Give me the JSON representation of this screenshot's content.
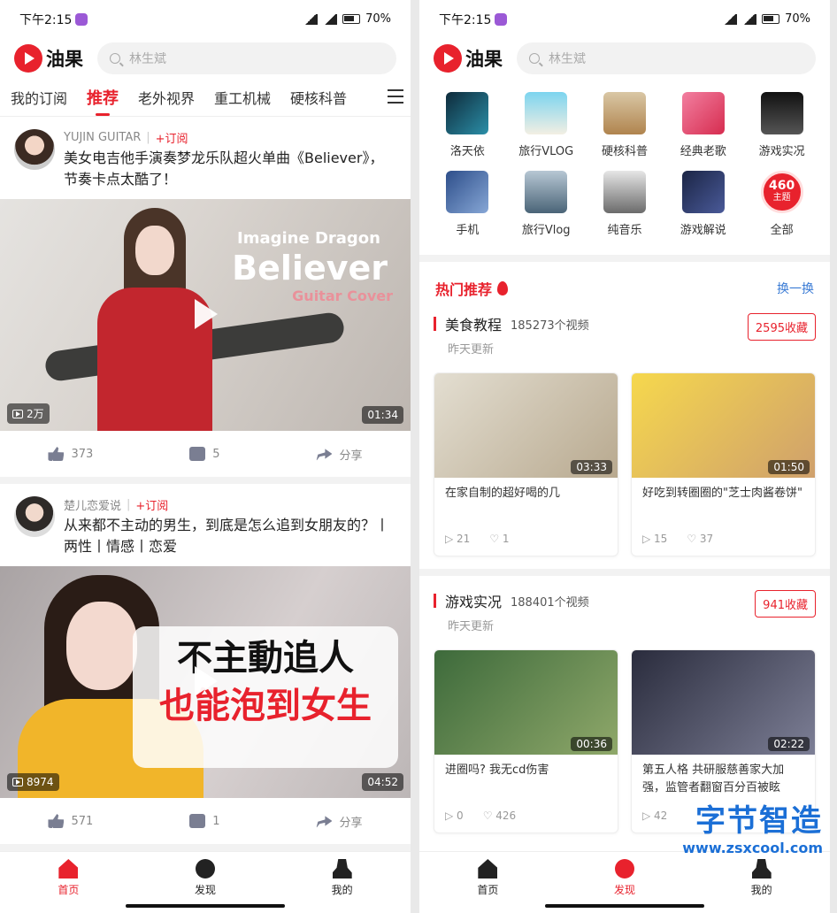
{
  "status": {
    "time": "下午2:15",
    "battery": "70%"
  },
  "app": {
    "name": "油果",
    "search_placeholder": "林生斌"
  },
  "tabs": [
    "我的订阅",
    "推荐",
    "老外视界",
    "重工机械",
    "硬核科普"
  ],
  "feed": [
    {
      "author": "YUJIN GUITAR",
      "subscribe": "+订阅",
      "title": "美女电吉他手演奏梦龙乐队超火单曲《Believer》，节奏卡点太酷了！",
      "views": "2万",
      "duration": "01:34",
      "likes": "373",
      "comments": "5",
      "share": "分享",
      "overlay": [
        "Imagine Dragon",
        "Believer",
        "Guitar Cover"
      ]
    },
    {
      "author": "楚儿恋爱说",
      "subscribe": "+订阅",
      "title": "从来都不主动的男生，到底是怎么追到女朋友的？丨两性丨情感丨恋爱",
      "views": "8974",
      "duration": "04:52",
      "likes": "571",
      "comments": "1",
      "share": "分享",
      "overlay": [
        "不主動追人",
        "也能泡到女生"
      ]
    }
  ],
  "nav": [
    {
      "label": "首页"
    },
    {
      "label": "发现"
    },
    {
      "label": "我的"
    }
  ],
  "categories": [
    {
      "label": "洛天依",
      "color": "#2b8fa8"
    },
    {
      "label": "旅行VLOG",
      "color": "#5ec3de"
    },
    {
      "label": "硬核科普",
      "color": "#c99a5b"
    },
    {
      "label": "经典老歌",
      "color": "#e0537a"
    },
    {
      "label": "游戏实况",
      "color": "#222222"
    },
    {
      "label": "手机",
      "color": "#4a6fb0"
    },
    {
      "label": "旅行Vlog",
      "color": "#6b8aa6"
    },
    {
      "label": "纯音乐",
      "color": "#8a8a8a"
    },
    {
      "label": "游戏解说",
      "color": "#2c3e72"
    }
  ],
  "more": {
    "count": "460",
    "unit": "主题",
    "label": "全部"
  },
  "hot": {
    "title": "热门推荐",
    "refresh": "换一换"
  },
  "topics": [
    {
      "name": "美食教程",
      "count": "185273个视频",
      "updated": "昨天更新",
      "collect": "2595收藏",
      "videos": [
        {
          "title": "在家自制的超好喝的几",
          "duration": "03:33",
          "plays": "21",
          "likes": "1",
          "color": "#d7d2c6"
        },
        {
          "title": "好吃到转圈圈的\"芝士肉酱卷饼\"",
          "duration": "01:50",
          "plays": "15",
          "likes": "37",
          "color": "#f2cf4a"
        }
      ]
    },
    {
      "name": "游戏实况",
      "count": "188401个视频",
      "updated": "昨天更新",
      "collect": "941收藏",
      "videos": [
        {
          "title": "进圈吗? 我无cd伤害",
          "duration": "00:36",
          "plays": "0",
          "likes": "426",
          "color": "#4f7a4a"
        },
        {
          "title": "第五人格 共研服慈善家大加强，监管者翻窗百分百被眩",
          "duration": "02:22",
          "plays": "42",
          "likes": "",
          "color": "#3b3e52"
        }
      ]
    }
  ],
  "watermark": {
    "line1": "字节智造",
    "line2": "www.zsxcool.com"
  }
}
